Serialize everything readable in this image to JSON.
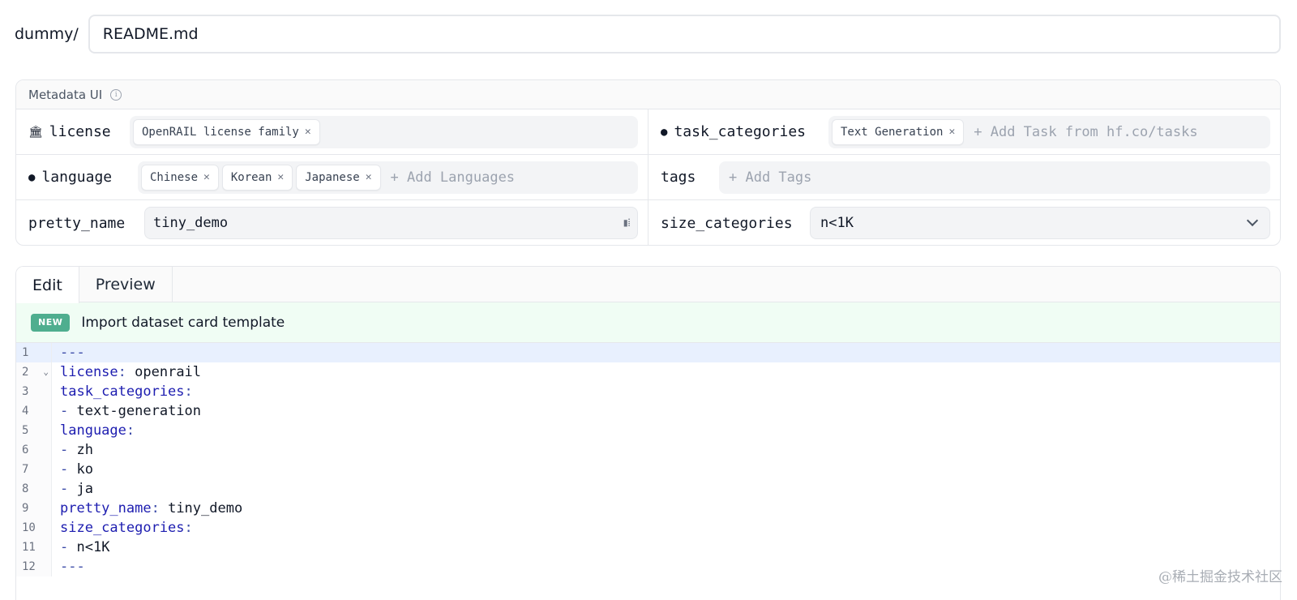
{
  "path": {
    "prefix": "dummy/",
    "filename": "README.md"
  },
  "metadata": {
    "title": "Metadata UI",
    "info_icon": "info-icon",
    "license": {
      "label": "license",
      "icon": "bank-icon",
      "chips": [
        "OpenRAIL license family"
      ]
    },
    "task_categories": {
      "label": "task_categories",
      "icon": "dot-icon",
      "chips": [
        "Text Generation"
      ],
      "placeholder": "+ Add Task from hf.co/tasks"
    },
    "language": {
      "label": "language",
      "icon": "speech-icon",
      "chips": [
        "Chinese",
        "Korean",
        "Japanese"
      ],
      "placeholder": "+ Add Languages"
    },
    "tags": {
      "label": "tags",
      "placeholder": "+ Add Tags"
    },
    "pretty_name": {
      "label": "pretty_name",
      "value": "tiny_demo"
    },
    "size_categories": {
      "label": "size_categories",
      "value": "n<1K"
    }
  },
  "editor": {
    "tabs": [
      "Edit",
      "Preview"
    ],
    "active_tab": "Edit",
    "banner": {
      "badge": "NEW",
      "text": "Import dataset card template"
    },
    "lines": [
      {
        "n": "1",
        "text": "---"
      },
      {
        "n": "2",
        "key": "license",
        "value": " openrail"
      },
      {
        "n": "3",
        "key": "task_categories",
        "value": ""
      },
      {
        "n": "4",
        "dash": "- ",
        "value": "text-generation"
      },
      {
        "n": "5",
        "key": "language",
        "value": ""
      },
      {
        "n": "6",
        "dash": "- ",
        "value": "zh"
      },
      {
        "n": "7",
        "dash": "- ",
        "value": "ko"
      },
      {
        "n": "8",
        "dash": "- ",
        "value": "ja"
      },
      {
        "n": "9",
        "key": "pretty_name",
        "value": " tiny_demo"
      },
      {
        "n": "10",
        "key": "size_categories",
        "value": ""
      },
      {
        "n": "11",
        "dash": "- ",
        "value": "n<1K"
      },
      {
        "n": "12",
        "text": "---"
      }
    ]
  },
  "watermark": "@稀土掘金技术社区",
  "colors": {
    "yaml_key": "#1d1db0",
    "badge": "#4fae8f",
    "banner_bg": "#f0fdf4",
    "active_line": "#e8f0fe"
  }
}
